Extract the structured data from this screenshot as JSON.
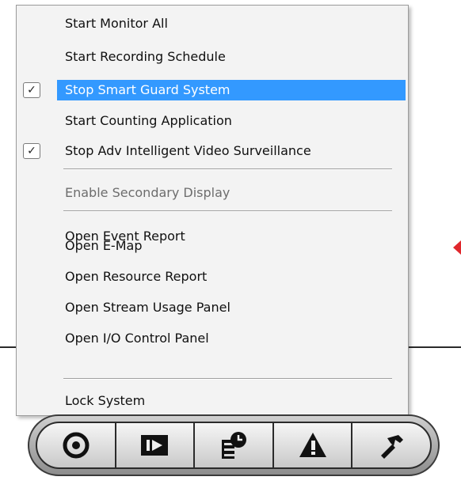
{
  "menu": {
    "items": [
      {
        "label": "Start Monitor All",
        "checked": false,
        "highlighted": false,
        "disabled": false
      },
      {
        "label": "Start Recording Schedule",
        "checked": false,
        "highlighted": false,
        "disabled": false
      },
      {
        "label": "Stop Smart Guard System",
        "checked": true,
        "highlighted": true,
        "disabled": false
      },
      {
        "label": "Start Counting Application",
        "checked": false,
        "highlighted": false,
        "disabled": false
      },
      {
        "label": "Stop Adv Intelligent Video Surveillance",
        "checked": true,
        "highlighted": false,
        "disabled": false
      },
      {
        "label": "Enable Secondary Display",
        "checked": false,
        "highlighted": false,
        "disabled": true
      },
      {
        "label": "Open Event Report",
        "checked": false,
        "highlighted": false,
        "disabled": false
      },
      {
        "label": "Open E-Map",
        "checked": false,
        "highlighted": false,
        "disabled": false
      },
      {
        "label": "Open Resource Report",
        "checked": false,
        "highlighted": false,
        "disabled": false
      },
      {
        "label": "Open Stream Usage Panel",
        "checked": false,
        "highlighted": false,
        "disabled": false
      },
      {
        "label": "Open I/O Control Panel",
        "checked": false,
        "highlighted": false,
        "disabled": false
      },
      {
        "label": "Lock System",
        "checked": false,
        "highlighted": false,
        "disabled": false
      }
    ],
    "check_glyph": "✓",
    "highlight_color": "#3399ff"
  },
  "toolbar": {
    "buttons": [
      {
        "icon": "record-icon"
      },
      {
        "icon": "playback-icon"
      },
      {
        "icon": "schedule-icon"
      },
      {
        "icon": "alert-icon"
      },
      {
        "icon": "tools-icon"
      }
    ]
  }
}
